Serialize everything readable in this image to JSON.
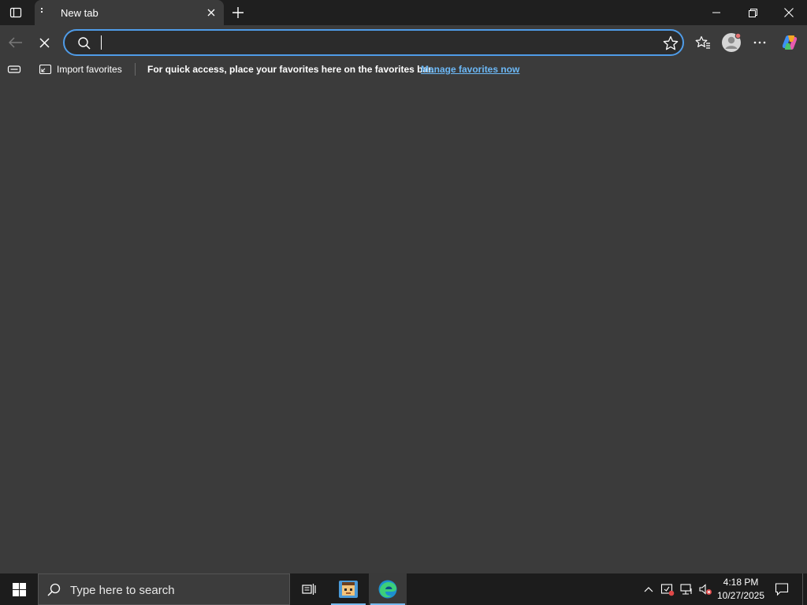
{
  "browser": {
    "tab": {
      "title": "New tab"
    },
    "omnibox": {
      "value": "",
      "placeholder": ""
    },
    "favorites_bar": {
      "import_label": "Import favorites",
      "message": "For quick access, place your favorites here on the favorites bar.",
      "manage_link": "Manage favorites now"
    },
    "accent_color": "#4f9ce8",
    "link_color": "#6cb8f6"
  },
  "taskbar": {
    "search_placeholder": "Type here to search",
    "clock": {
      "time": "4:18 PM",
      "date": "10/27/2025"
    },
    "pinned_apps": [
      "task-view-icon",
      "minecraft-icon",
      "edge-icon"
    ]
  },
  "icons": {
    "titlebar": [
      "tab-actions-icon",
      "tab-menu-icon",
      "close-icon",
      "new-tab-icon",
      "minimize-icon",
      "restore-icon",
      "close-window-icon"
    ],
    "toolbar": [
      "back-arrow-icon",
      "stop-loading-icon",
      "search-icon",
      "star-icon",
      "favorites-icon",
      "profile-icon",
      "more-icon",
      "copilot-icon"
    ],
    "tray": [
      "chevron-up-icon",
      "security-icon",
      "network-icon",
      "volume-muted-icon",
      "notification-icon"
    ]
  }
}
